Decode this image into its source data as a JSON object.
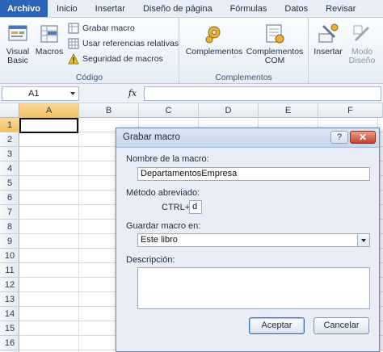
{
  "ribbon_tabs": [
    {
      "label": "Archivo"
    },
    {
      "label": "Inicio"
    },
    {
      "label": "Insertar"
    },
    {
      "label": "Diseño de página"
    },
    {
      "label": "Fórmulas"
    },
    {
      "label": "Datos"
    },
    {
      "label": "Revisar"
    }
  ],
  "ribbon": {
    "codigo": {
      "label": "Código",
      "visual_basic": "Visual Basic",
      "macros": "Macros",
      "grabar_macro": "Grabar macro",
      "usar_referencias": "Usar referencias relativas",
      "seguridad": "Seguridad de macros"
    },
    "complementos": {
      "label": "Complementos",
      "complementos_btn": "Complementos",
      "complementos_com": "Complementos COM"
    },
    "controles": {
      "insertar": "Insertar",
      "modo_diseno": "Modo Diseño"
    }
  },
  "formula_bar": {
    "name_box": "A1",
    "fx": "fx",
    "formula": ""
  },
  "grid": {
    "columns": [
      "A",
      "B",
      "C",
      "D",
      "E",
      "F"
    ],
    "rows": [
      "1",
      "2",
      "3",
      "4",
      "5",
      "6",
      "7",
      "8",
      "9",
      "10",
      "11",
      "12",
      "13",
      "14",
      "15",
      "16"
    ],
    "selected_cell": "A1"
  },
  "dialog": {
    "title": "Grabar macro",
    "help": "?",
    "close": "✕",
    "name_label": "Nombre de la macro:",
    "name_value": "DepartamentosEmpresa",
    "shortcut_label": "Método abreviado:",
    "ctrl_label": "CTRL+",
    "shortcut_value": "d",
    "store_label": "Guardar macro en:",
    "store_value": "Este libro",
    "description_label": "Descripción:",
    "description_value": "",
    "accept": "Aceptar",
    "cancel": "Cancelar"
  },
  "colors": {
    "file_tab": "#2b63b8",
    "selection_header": "#f1c15f",
    "dialog_bg": "#e9eef6"
  }
}
